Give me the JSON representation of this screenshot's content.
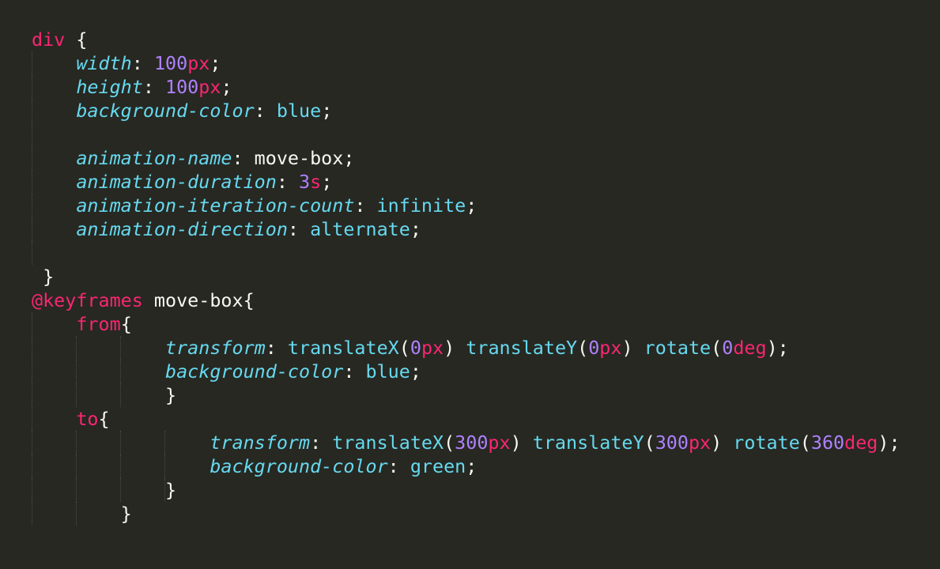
{
  "code": {
    "lines": [
      [
        {
          "t": "div",
          "c": "kw"
        },
        {
          "t": " {",
          "c": "pl"
        }
      ],
      [
        {
          "t": "    ",
          "c": "pl"
        },
        {
          "t": "width",
          "c": "prop"
        },
        {
          "t": ": ",
          "c": "pl"
        },
        {
          "t": "100",
          "c": "num"
        },
        {
          "t": "px",
          "c": "unit"
        },
        {
          "t": ";",
          "c": "pl"
        }
      ],
      [
        {
          "t": "    ",
          "c": "pl"
        },
        {
          "t": "height",
          "c": "prop"
        },
        {
          "t": ": ",
          "c": "pl"
        },
        {
          "t": "100",
          "c": "num"
        },
        {
          "t": "px",
          "c": "unit"
        },
        {
          "t": ";",
          "c": "pl"
        }
      ],
      [
        {
          "t": "    ",
          "c": "pl"
        },
        {
          "t": "background-color",
          "c": "prop"
        },
        {
          "t": ": ",
          "c": "pl"
        },
        {
          "t": "blue",
          "c": "val"
        },
        {
          "t": ";",
          "c": "pl"
        }
      ],
      [],
      [
        {
          "t": "    ",
          "c": "pl"
        },
        {
          "t": "animation-name",
          "c": "prop"
        },
        {
          "t": ": ",
          "c": "pl"
        },
        {
          "t": "move-box",
          "c": "id"
        },
        {
          "t": ";",
          "c": "pl"
        }
      ],
      [
        {
          "t": "    ",
          "c": "pl"
        },
        {
          "t": "animation-duration",
          "c": "prop"
        },
        {
          "t": ": ",
          "c": "pl"
        },
        {
          "t": "3",
          "c": "num"
        },
        {
          "t": "s",
          "c": "unit"
        },
        {
          "t": ";",
          "c": "pl"
        }
      ],
      [
        {
          "t": "    ",
          "c": "pl"
        },
        {
          "t": "animation-iteration-count",
          "c": "prop"
        },
        {
          "t": ": ",
          "c": "pl"
        },
        {
          "t": "infinite",
          "c": "val"
        },
        {
          "t": ";",
          "c": "pl"
        }
      ],
      [
        {
          "t": "    ",
          "c": "pl"
        },
        {
          "t": "animation-direction",
          "c": "prop"
        },
        {
          "t": ": ",
          "c": "pl"
        },
        {
          "t": "alternate",
          "c": "val"
        },
        {
          "t": ";",
          "c": "pl"
        }
      ],
      [],
      [
        {
          "t": " }",
          "c": "pl"
        }
      ],
      [
        {
          "t": "@keyframes",
          "c": "kw"
        },
        {
          "t": " move-box{",
          "c": "pl"
        }
      ],
      [
        {
          "t": "    ",
          "c": "pl"
        },
        {
          "t": "from",
          "c": "kw"
        },
        {
          "t": "{",
          "c": "pl"
        }
      ],
      [
        {
          "t": "            ",
          "c": "pl"
        },
        {
          "t": "transform",
          "c": "prop"
        },
        {
          "t": ": ",
          "c": "pl"
        },
        {
          "t": "translateX",
          "c": "val"
        },
        {
          "t": "(",
          "c": "pl"
        },
        {
          "t": "0",
          "c": "num"
        },
        {
          "t": "px",
          "c": "unit"
        },
        {
          "t": ") ",
          "c": "pl"
        },
        {
          "t": "translateY",
          "c": "val"
        },
        {
          "t": "(",
          "c": "pl"
        },
        {
          "t": "0",
          "c": "num"
        },
        {
          "t": "px",
          "c": "unit"
        },
        {
          "t": ") ",
          "c": "pl"
        },
        {
          "t": "rotate",
          "c": "val"
        },
        {
          "t": "(",
          "c": "pl"
        },
        {
          "t": "0",
          "c": "num"
        },
        {
          "t": "deg",
          "c": "unit"
        },
        {
          "t": ");",
          "c": "pl"
        }
      ],
      [
        {
          "t": "            ",
          "c": "pl"
        },
        {
          "t": "background-color",
          "c": "prop"
        },
        {
          "t": ": ",
          "c": "pl"
        },
        {
          "t": "blue",
          "c": "val"
        },
        {
          "t": ";",
          "c": "pl"
        }
      ],
      [
        {
          "t": "            }",
          "c": "pl"
        }
      ],
      [
        {
          "t": "    ",
          "c": "pl"
        },
        {
          "t": "to",
          "c": "kw"
        },
        {
          "t": "{",
          "c": "pl"
        }
      ],
      [
        {
          "t": "                ",
          "c": "pl"
        },
        {
          "t": "transform",
          "c": "prop"
        },
        {
          "t": ": ",
          "c": "pl"
        },
        {
          "t": "translateX",
          "c": "val"
        },
        {
          "t": "(",
          "c": "pl"
        },
        {
          "t": "300",
          "c": "num"
        },
        {
          "t": "px",
          "c": "unit"
        },
        {
          "t": ") ",
          "c": "pl"
        },
        {
          "t": "translateY",
          "c": "val"
        },
        {
          "t": "(",
          "c": "pl"
        },
        {
          "t": "300",
          "c": "num"
        },
        {
          "t": "px",
          "c": "unit"
        },
        {
          "t": ") ",
          "c": "pl"
        },
        {
          "t": "rotate",
          "c": "val"
        },
        {
          "t": "(",
          "c": "pl"
        },
        {
          "t": "360",
          "c": "num"
        },
        {
          "t": "deg",
          "c": "unit"
        },
        {
          "t": ");",
          "c": "pl"
        }
      ],
      [
        {
          "t": "                ",
          "c": "pl"
        },
        {
          "t": "background-color",
          "c": "prop"
        },
        {
          "t": ": ",
          "c": "pl"
        },
        {
          "t": "green",
          "c": "val"
        },
        {
          "t": ";",
          "c": "pl"
        }
      ],
      [
        {
          "t": "            }",
          "c": "pl"
        }
      ],
      [
        {
          "t": "        }",
          "c": "pl"
        }
      ]
    ]
  },
  "colors": {
    "background": "#272822",
    "keyword": "#f92672",
    "property": "#66d9ef",
    "number": "#ae81ff",
    "plain": "#f8f8f2"
  }
}
